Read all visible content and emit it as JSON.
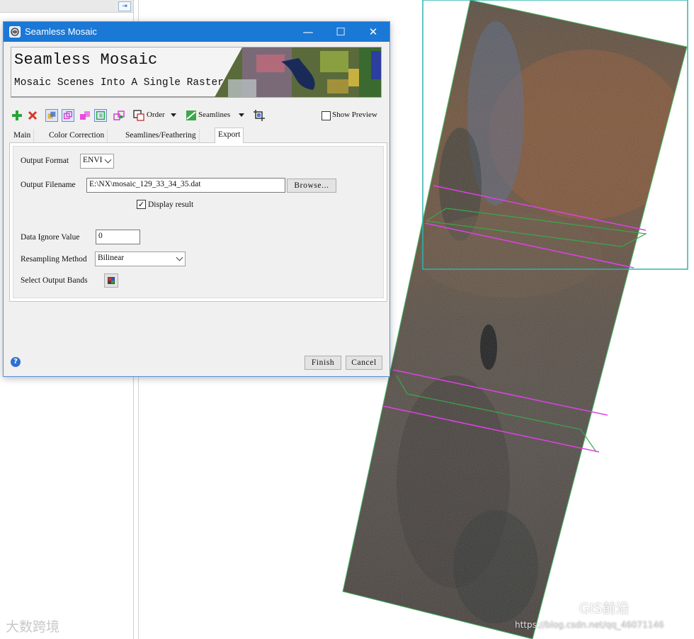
{
  "window": {
    "title": "Seamless Mosaic",
    "controls": {
      "minimize": "—",
      "maximize": "☐",
      "close": "✕"
    }
  },
  "banner": {
    "title": "Seamless Mosaic",
    "subtitle": "Mosaic Scenes Into A Single Raster"
  },
  "toolbar": {
    "icons": [
      "add-icon",
      "remove-icon",
      "footprint-icon",
      "overlap-icon",
      "color-icon",
      "export-icon",
      "layers-icon"
    ],
    "order_label": "Order",
    "seamlines_label": "Seamlines",
    "show_preview_label": "Show Preview",
    "show_preview_checked": false
  },
  "tabs": [
    {
      "label": "Main",
      "active": false
    },
    {
      "label": "Color Correction",
      "active": false
    },
    {
      "label": "Seamlines/Feathering",
      "active": false
    },
    {
      "label": "Export",
      "active": true
    }
  ],
  "export": {
    "output_format_label": "Output Format",
    "output_format_value": "ENVI",
    "output_filename_label": "Output Filename",
    "output_filename_value": "E:\\NX\\mosaic_129_33_34_35.dat",
    "browse_label": "Browse...",
    "display_result_label": "Display result",
    "display_result_checked": true,
    "data_ignore_label": "Data Ignore Value",
    "data_ignore_value": "0",
    "resampling_label": "Resampling Method",
    "resampling_value": "Bilinear",
    "select_bands_label": "Select Output Bands"
  },
  "footer": {
    "help_glyph": "?",
    "finish_label": "Finish",
    "cancel_label": "Cancel"
  },
  "watermarks": {
    "left": "大数跨境",
    "right": "GIS前沿",
    "url": "https://blog.csdn.net/qq_46071146"
  },
  "colors": {
    "titlebar": "#1a78d6",
    "seamline": "#e040e8",
    "footprint": "#3aa84a",
    "scene_outline": "#2bb5b0"
  }
}
